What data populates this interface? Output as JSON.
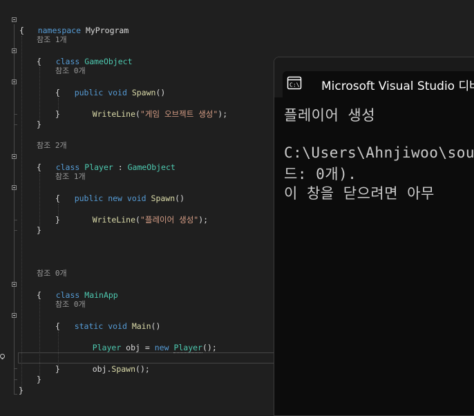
{
  "editor": {
    "lines": {
      "l1": {
        "kw": "namespace",
        "name": "MyProgram"
      },
      "l2": "{",
      "l3_hint": "참조 1개",
      "l4": {
        "kw": "class",
        "name": "GameObject"
      },
      "l5": "{",
      "l6_hint": "참조 0개",
      "l7": {
        "kw1": "public",
        "kw2": "void",
        "method": "Spawn",
        "rest": "()"
      },
      "l8": "{",
      "l9": {
        "method": "WriteLine",
        "open": "(",
        "str": "\"게임 오브젝트 생성\"",
        "close": ");"
      },
      "l10": "}",
      "l11": "}",
      "l12_hint": "참조 2개",
      "l13": {
        "kw": "class",
        "name": "Player",
        "sep": " : ",
        "base": "GameObject"
      },
      "l14": "{",
      "l15_hint": "참조 1개",
      "l16": {
        "kw1": "public",
        "kw2": "new",
        "kw3": "void",
        "method": "Spawn",
        "rest": "()"
      },
      "l17": "{",
      "l18": {
        "method": "WriteLine",
        "open": "(",
        "str": "\"플레이어 생성\"",
        "close": ");"
      },
      "l19": "}",
      "l20": "}",
      "l21_hint": "참조 0개",
      "l22": {
        "kw": "class",
        "name": "MainApp"
      },
      "l23": "{",
      "l24_hint": "참조 0개",
      "l25": {
        "kw1": "static",
        "kw2": "void",
        "method": "Main",
        "rest": "()"
      },
      "l26": "{",
      "l27": {
        "type": "Player",
        "var": " obj = ",
        "kw": "new",
        "ctor": "Player",
        "rest": "();"
      },
      "l28": {
        "obj": "obj.",
        "method": "Spawn",
        "rest": "();"
      },
      "l29": "}",
      "l30": "}",
      "l31": "}"
    }
  },
  "console": {
    "title": "Microsoft Visual Studio 디버",
    "output": [
      "플레이어 생성",
      "",
      "C:\\Users\\Ahnjiwoo\\sou",
      "드: 0개).",
      "이 창을 닫으려면 아무"
    ]
  },
  "colors": {
    "background": "#1f1f1f",
    "keyword": "#569cd6",
    "type": "#4ec9b0",
    "method": "#dcdcaa",
    "string": "#d69d85",
    "console_bg": "#0c0c0c"
  }
}
